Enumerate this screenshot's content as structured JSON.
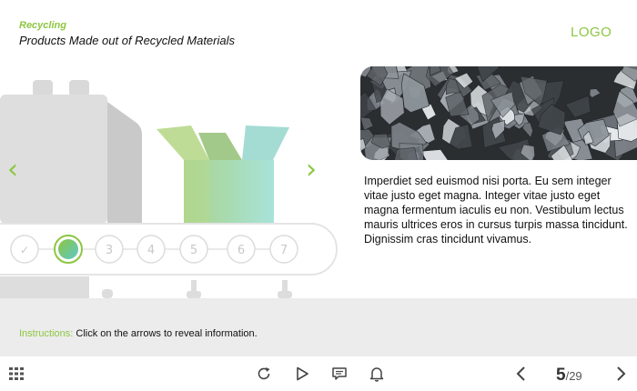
{
  "header": {
    "category": "Recycling",
    "title": "Products Made out of Recycled Materials",
    "logo": "LOGO"
  },
  "carousel": {
    "prev_icon": "chevron-left-icon",
    "next_icon": "chevron-right-icon",
    "steps": [
      {
        "label": "✓",
        "state": "done"
      },
      {
        "label": "",
        "state": "active"
      },
      {
        "label": "3",
        "state": "pending"
      },
      {
        "label": "4",
        "state": "pending"
      },
      {
        "label": "5",
        "state": "pending"
      },
      {
        "label": "6",
        "state": "pending"
      },
      {
        "label": "7",
        "state": "pending"
      }
    ]
  },
  "content": {
    "body": "Imperdiet sed euismod nisi porta. Eu sem integer vitae justo eget magna. Integer vitae justo eget magna fermentum iaculis eu non. Vestibulum lectus mauris ultrices eros in cursus turpis massa tincidunt. Dignissim cras tincidunt vivamus."
  },
  "instructions": {
    "label": "Instructions:",
    "text": " Click on the arrows to reveal information."
  },
  "toolbar": {
    "menu_icon": "grid-menu-icon",
    "replay_icon": "replay-icon",
    "play_icon": "play-icon",
    "comment_icon": "comment-icon",
    "bell_icon": "bell-icon",
    "prev_icon": "chevron-left-icon",
    "next_icon": "chevron-right-icon",
    "current_page": "5",
    "total_pages": "/29"
  },
  "colors": {
    "accent": "#8dc63f",
    "panel": "#ececec"
  }
}
